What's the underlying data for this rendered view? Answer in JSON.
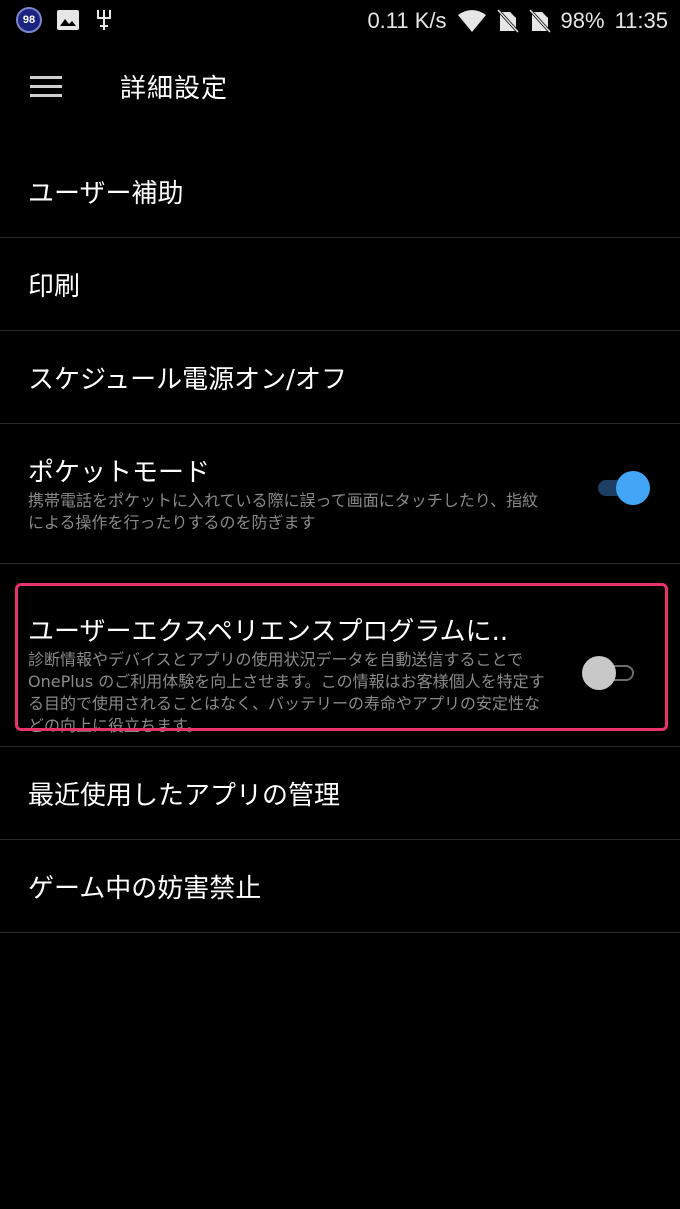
{
  "status_bar": {
    "badge_number": "98",
    "network_speed": "0.11 K/s",
    "battery": "98%",
    "time": "11:35",
    "icons": [
      "notification-badge-icon",
      "image-icon",
      "usb-debug-icon",
      "wifi-icon",
      "no-sim-icon",
      "no-sim-icon",
      "battery-icon"
    ]
  },
  "toolbar": {
    "title": "詳細設定"
  },
  "settings": [
    {
      "title": "ユーザー補助"
    },
    {
      "title": "印刷"
    },
    {
      "title": "スケジュール電源オン/オフ"
    },
    {
      "title": "ポケットモード",
      "summary": "携帯電話をポケットに入れている際に誤って画面にタッチしたり、指紋による操作を行ったりするのを防ぎます",
      "toggle": true
    },
    {
      "title": "ユーザーエクスペリエンスプログラムに..",
      "summary": "診断情報やデバイスとアプリの使用状況データを自動送信することで OnePlus のご利用体験を向上させます。この情報はお客様個人を特定する目的で使用されることはなく、バッテリーの寿命やアプリの安定性などの向上に役立ちます。",
      "toggle": false
    },
    {
      "title": "最近使用したアプリの管理"
    },
    {
      "title": "ゲーム中の妨害禁止"
    }
  ],
  "colors": {
    "background": "#000000",
    "accent": "#42a5f5",
    "highlight": "#e8336a",
    "divider": "#2c2c2c",
    "summary_text": "#8a8a8a"
  }
}
